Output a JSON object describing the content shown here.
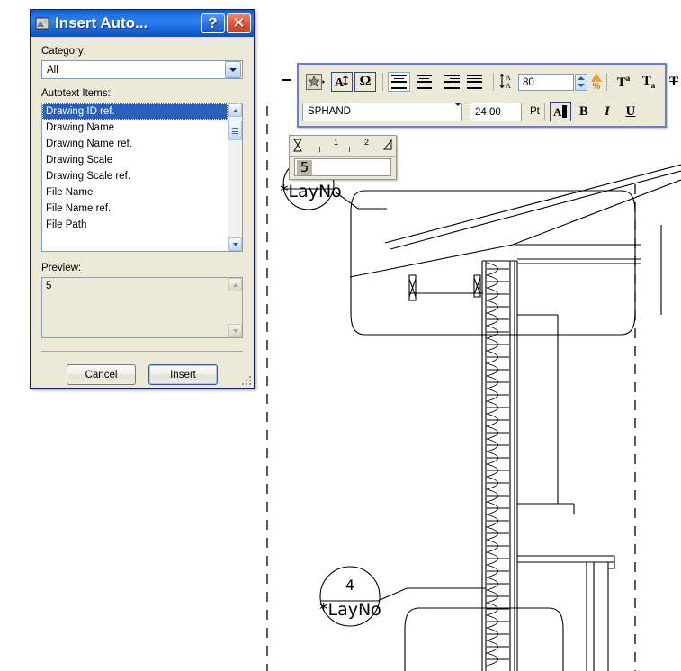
{
  "dialog": {
    "title": "Insert Auto...",
    "icon": "autotext-icon",
    "help_button": "?",
    "close_button": "✕",
    "category_label": "Category:",
    "category_value": "All",
    "items_label": "Autotext Items:",
    "items": [
      "Drawing ID ref.",
      "Drawing Name",
      "Drawing Name ref.",
      "Drawing Scale",
      "Drawing Scale ref.",
      "File Name",
      "File Name ref.",
      "File Path"
    ],
    "selected_index": 0,
    "preview_label": "Preview:",
    "preview_value": "5",
    "cancel_label": "Cancel",
    "insert_label": "Insert",
    "accent_titlebar": "#1a6fe0",
    "accent_selection": "#2a5fba",
    "face_color": "#ece9d8"
  },
  "format_toolbar": {
    "row1": {
      "favorites_label": "★",
      "autotext_label": "A",
      "symbol_label": "Ω",
      "align_left": "align-left",
      "align_center": "align-center",
      "align_right": "align-right",
      "align_justify": "align-justify",
      "line_spacing_icon": "line-spacing-icon",
      "line_spacing_value": "80",
      "percent_label": "%",
      "superscript_label": "T",
      "superscript_sup": "a",
      "subscript_label": "T",
      "subscript_sub": "a",
      "strikethrough_label": "T"
    },
    "row2": {
      "font_name": "SPHAND",
      "font_size": "24.00",
      "unit_label": "Pt",
      "text_color_label": "A",
      "bold_label": "B",
      "italic_label": "I",
      "underline_label": "U"
    },
    "border_color": "#6d7fc4"
  },
  "mini_editor": {
    "ruler_ticks": [
      "1",
      "2"
    ],
    "text_value": "5",
    "first_line_indent_icon": "indent-marker-icon",
    "right_indent_icon": "right-indent-marker-icon"
  },
  "drawing": {
    "callout_top": {
      "number": "",
      "tag": "*LayNo"
    },
    "callout_bottom": {
      "number": "4",
      "tag": "*LayNo"
    },
    "description": "architectural wall section with sloped roof, insulation batt hatching and sill detail"
  }
}
